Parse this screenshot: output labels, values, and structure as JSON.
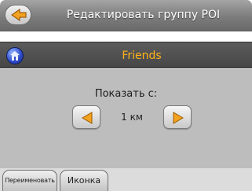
{
  "header": {
    "title": "Редактировать группу POI",
    "back_icon": "arrow-left-icon"
  },
  "group": {
    "name": "Friends",
    "icon": "house-icon"
  },
  "visibility": {
    "label": "Показать с:",
    "value": "1 км"
  },
  "tabs": [
    {
      "label": "Переименовать"
    },
    {
      "label": "Иконка"
    }
  ],
  "colors": {
    "header": "#7c7c7c",
    "group_bar": "#4f4f4f",
    "group_name": "#ffb21a",
    "panel": "#bdbdbd",
    "arrow": "#f2a21e"
  }
}
